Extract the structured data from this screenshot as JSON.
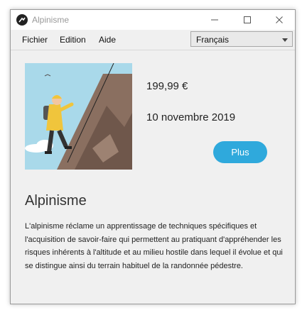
{
  "window": {
    "title": "Alpinisme"
  },
  "menu": {
    "items": [
      "Fichier",
      "Edition",
      "Aide"
    ]
  },
  "language": {
    "selected": "Français"
  },
  "product": {
    "price": "199,99 €",
    "date": "10 novembre 2019",
    "more_label": "Plus",
    "heading": "Alpinisme",
    "description": "L'alpinisme réclame un apprentissage de techniques spécifiques et l'acquisition de savoir-faire qui permettent au pratiquant d'appréhender les risques inhérents à l'altitude et au milieu hostile dans lequel il évolue et qui se distingue ainsi du terrain habituel de la randonnée pédestre."
  },
  "colors": {
    "accent": "#2fa9dc",
    "sky": "#a9d9ea",
    "rock": "#8a6f60",
    "jacket": "#f0c53c"
  },
  "icons": [
    "app-icon",
    "minimize-icon",
    "maximize-icon",
    "close-icon",
    "chevron-down-icon"
  ]
}
